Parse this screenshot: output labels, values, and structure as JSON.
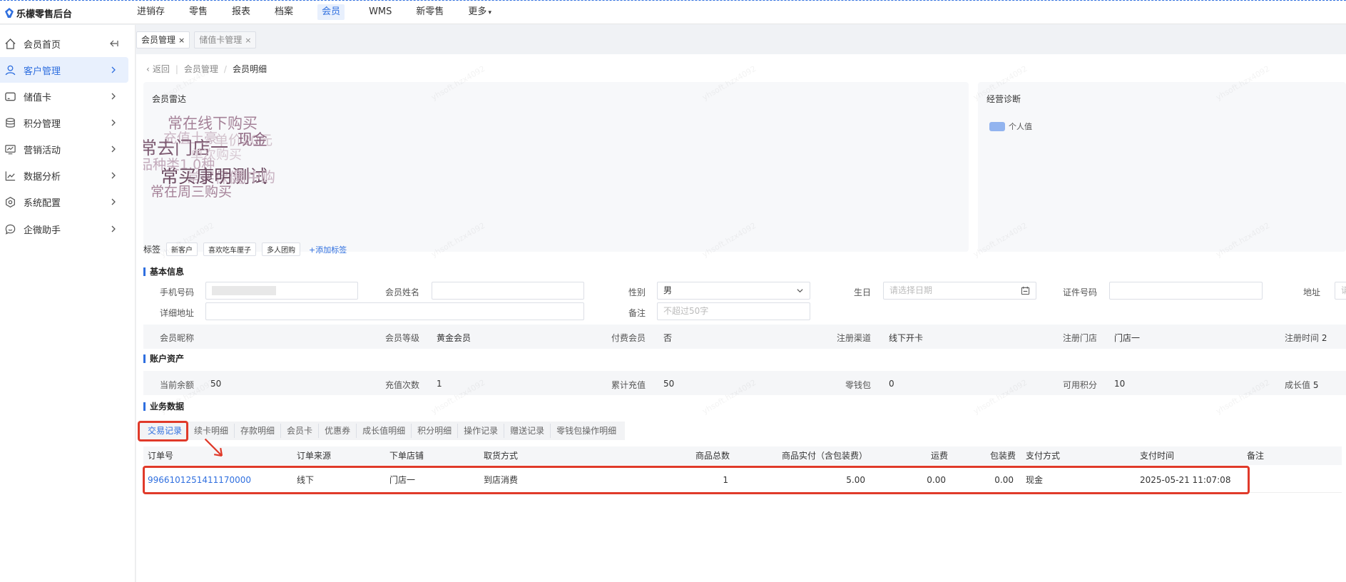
{
  "app": {
    "brand": "乐檬零售后台"
  },
  "topnav": [
    "进销存",
    "零售",
    "报表",
    "档案",
    "会员",
    "WMS",
    "新零售",
    "更多"
  ],
  "topnav_active": "会员",
  "sidebar": [
    {
      "label": "会员首页",
      "icon": "home-icon"
    },
    {
      "label": "客户管理",
      "icon": "user-icon"
    },
    {
      "label": "储值卡",
      "icon": "card-icon"
    },
    {
      "label": "积分管理",
      "icon": "database-icon"
    },
    {
      "label": "营销活动",
      "icon": "monitor-icon"
    },
    {
      "label": "数据分析",
      "icon": "trend-icon"
    },
    {
      "label": "系统配置",
      "icon": "settings-icon"
    },
    {
      "label": "企微助手",
      "icon": "chat-icon"
    }
  ],
  "sidebar_active": "客户管理",
  "tabs": [
    {
      "label": "会员管理",
      "close": "×"
    },
    {
      "label": "储值卡管理",
      "close": "×"
    }
  ],
  "breadcrumb": {
    "back": "返回",
    "parent": "会员管理",
    "current": "会员明细"
  },
  "radar": {
    "title": "会员雷达",
    "words": [
      "常在线下购买",
      "充值土豪",
      "单价20元",
      "常去门店一",
      "现金",
      "单次购买",
      "品种类1.0种",
      "常买保健",
      "常买康明测试",
      "常在周三购买",
      "周中购"
    ]
  },
  "diagnosis": {
    "title": "经营诊断",
    "legend": "个人值"
  },
  "tags": {
    "label": "标签",
    "items": [
      "新客户",
      "喜欢吃车厘子",
      "多人团购"
    ],
    "add": "+添加标签"
  },
  "basic": {
    "title": "基本信息",
    "phone_label": "手机号码",
    "name_label": "会员姓名",
    "gender_label": "性别",
    "gender_value": "男",
    "birthday_label": "生日",
    "birthday_placeholder": "请选择日期",
    "id_label": "证件号码",
    "addr_label": "地址",
    "addr_placeholder": "请",
    "detail_label": "详细地址",
    "remark_label": "备注",
    "remark_placeholder": "不超过50字",
    "nick_label": "会员昵称",
    "level_label": "会员等级",
    "level_value": "黄金会员",
    "paid_label": "付费会员",
    "paid_value": "否",
    "channel_label": "注册渠道",
    "channel_value": "线下开卡",
    "store_label": "注册门店",
    "store_value": "门店一",
    "regtime_label": "注册时间",
    "regtime_value": "2"
  },
  "assets": {
    "title": "账户资产",
    "balance_label": "当前余额",
    "balance_value": "50",
    "recharge_count_label": "充值次数",
    "recharge_count_value": "1",
    "total_recharge_label": "累计充值",
    "total_recharge_value": "50",
    "change_label": "零钱包",
    "change_value": "0",
    "points_label": "可用积分",
    "points_value": "10",
    "growth_label": "成长值",
    "growth_value": "5"
  },
  "business": {
    "title": "业务数据",
    "tabs": [
      "交易记录",
      "续卡明细",
      "存款明细",
      "会员卡",
      "优惠券",
      "成长值明细",
      "积分明细",
      "操作记录",
      "赠送记录",
      "零钱包操作明细"
    ],
    "active": "交易记录"
  },
  "table": {
    "headers": [
      "订单号",
      "订单来源",
      "下单店铺",
      "取货方式",
      "商品总数",
      "商品实付（含包装费）",
      "运费",
      "包装费",
      "支付方式",
      "支付时间",
      "备注"
    ],
    "rows": [
      [
        "9966101251411170000",
        "线下",
        "门店一",
        "到店消费",
        "1",
        "5.00",
        "0.00",
        "0.00",
        "现金",
        "2025-05-21 11:07:08",
        ""
      ]
    ]
  },
  "watermark": "yhsoft.hzx4092",
  "colors": {
    "accent": "#2f6fdf",
    "highlight": "#e03a2a",
    "wordcloud": "#a58298"
  }
}
